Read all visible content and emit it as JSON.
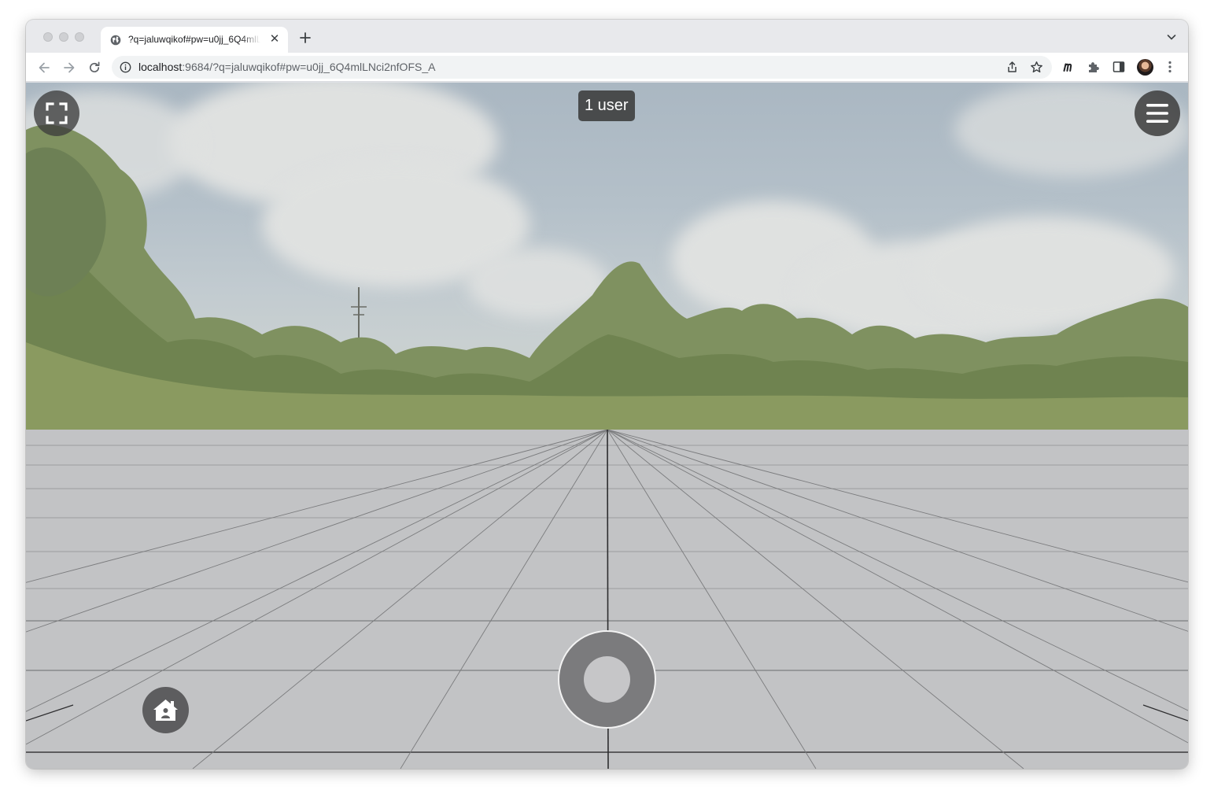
{
  "browser": {
    "tab": {
      "title": "?q=jaluwqikof#pw=u0jj_6Q4mlLNci2nfOFS_A",
      "close_glyph": "✕"
    },
    "address": {
      "host": "localhost",
      "rest": ":9684/?q=jaluwqikof#pw=u0jj_6Q4mlLNci2nfOFS_A"
    },
    "icons": {
      "back": "back-arrow-icon",
      "forward": "forward-arrow-icon",
      "reload": "reload-icon",
      "site_info": "info-icon",
      "share": "share-icon",
      "bookmark": "star-icon",
      "extension_m": "m-extension-icon",
      "extensions": "puzzle-icon",
      "side_panel": "side-panel-icon",
      "menu": "kebab-menu-icon"
    }
  },
  "scene": {
    "users_badge": "1 user",
    "icons": {
      "fullscreen": "fullscreen-icon",
      "menu": "hamburger-icon",
      "home": "home-icon",
      "joystick": "joystick"
    },
    "colors": {
      "floor": "#c2c3c5",
      "controls": "#5d5d5f",
      "joystick_ring": "#7b7b7d"
    }
  }
}
